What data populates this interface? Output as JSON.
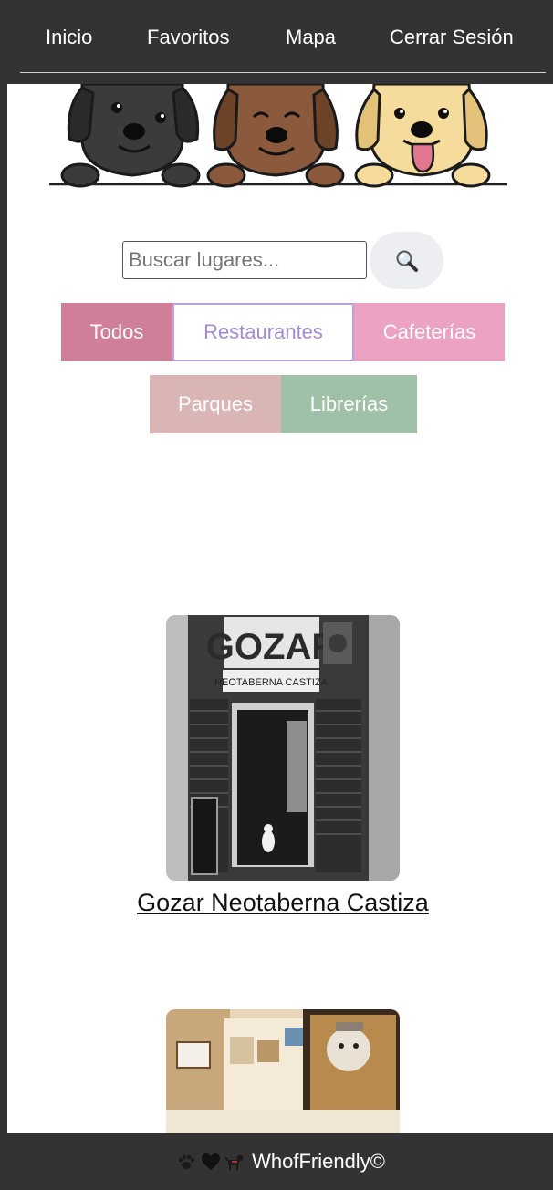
{
  "nav": {
    "items": [
      {
        "label": "Inicio"
      },
      {
        "label": "Favoritos"
      },
      {
        "label": "Mapa"
      },
      {
        "label": "Cerrar Sesión"
      }
    ]
  },
  "hero": {
    "icons": [
      "black-dog-icon",
      "brown-dog-icon",
      "golden-dog-icon"
    ]
  },
  "search": {
    "placeholder": "Buscar lugares...",
    "value": "",
    "button_icon": "magnifier-icon"
  },
  "categories": [
    {
      "label": "Todos",
      "color": "#d07f9b"
    },
    {
      "label": "Restaurantes",
      "color": "#a48ad1",
      "selected": true
    },
    {
      "label": "Cafeterías",
      "color": "#eba2c3"
    },
    {
      "label": "Parques",
      "color": "#d9b6b5"
    },
    {
      "label": "Librerías",
      "color": "#9fc1a8"
    }
  ],
  "places": [
    {
      "title": "Gozar Neotaberna Castiza",
      "image_sign": "GOZAR",
      "image_subsign": "NEOTABERNA CASTIZA"
    },
    {
      "title": ""
    }
  ],
  "footer": {
    "icons": [
      "paw-icon",
      "heart-icon",
      "dog-icon"
    ],
    "text": "WhofFriendly©"
  },
  "colors": {
    "nav_bg": "#333333",
    "footer_bg": "#333333",
    "search_button_bg": "#eceef1"
  }
}
